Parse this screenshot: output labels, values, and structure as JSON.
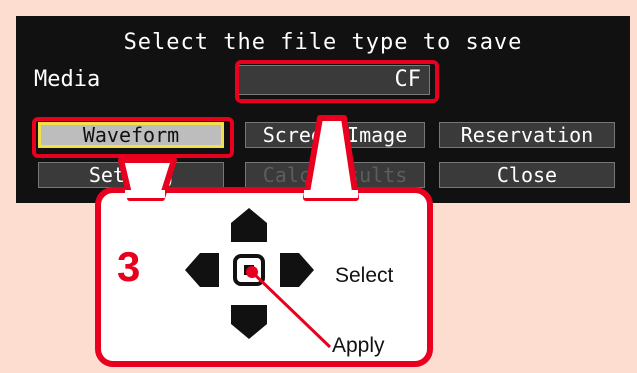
{
  "dialog": {
    "title": "Select the file type to save",
    "media_label": "Media",
    "media_value": "CF",
    "buttons": {
      "waveform": "Waveform",
      "screen_image": "Screen Image",
      "reservation": "Reservation",
      "setting": "Setting",
      "calc_results": "Calc Results",
      "close": "Close"
    }
  },
  "callout": {
    "step": "3",
    "select_label": "Select",
    "apply_label": "Apply"
  },
  "colors": {
    "background": "#fdddd0",
    "panel": "#111111",
    "highlight": "#e8001e",
    "selection_border": "#f2e04a"
  }
}
